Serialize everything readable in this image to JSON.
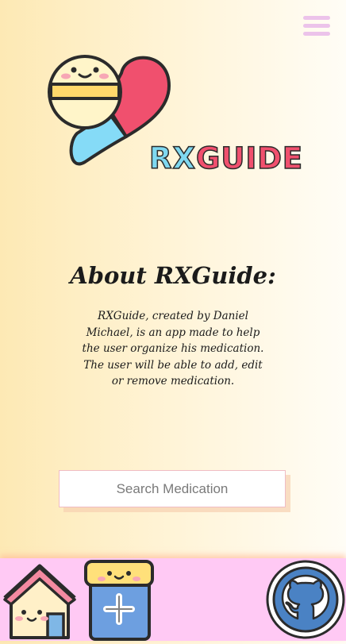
{
  "header": {
    "menu_icon": "hamburger-menu-icon"
  },
  "logo": {
    "brand_rx": "RX",
    "brand_guide": "GUIDE"
  },
  "about": {
    "title": "About RXGuide:",
    "text": "RXGuide, created by Daniel Michael, is an app made to help the user organize his medication. The user will be able to add, edit or remove medication."
  },
  "search": {
    "placeholder": "Search Medication",
    "value": ""
  },
  "footer": {
    "home_icon": "home-icon",
    "add_icon": "add-medication-icon",
    "github_icon": "github-icon"
  },
  "colors": {
    "pink_accent": "#f0506e",
    "blue_accent": "#7fd8f0",
    "footer_bg": "#ffc9f4",
    "menu_color": "#ecc3ea"
  }
}
